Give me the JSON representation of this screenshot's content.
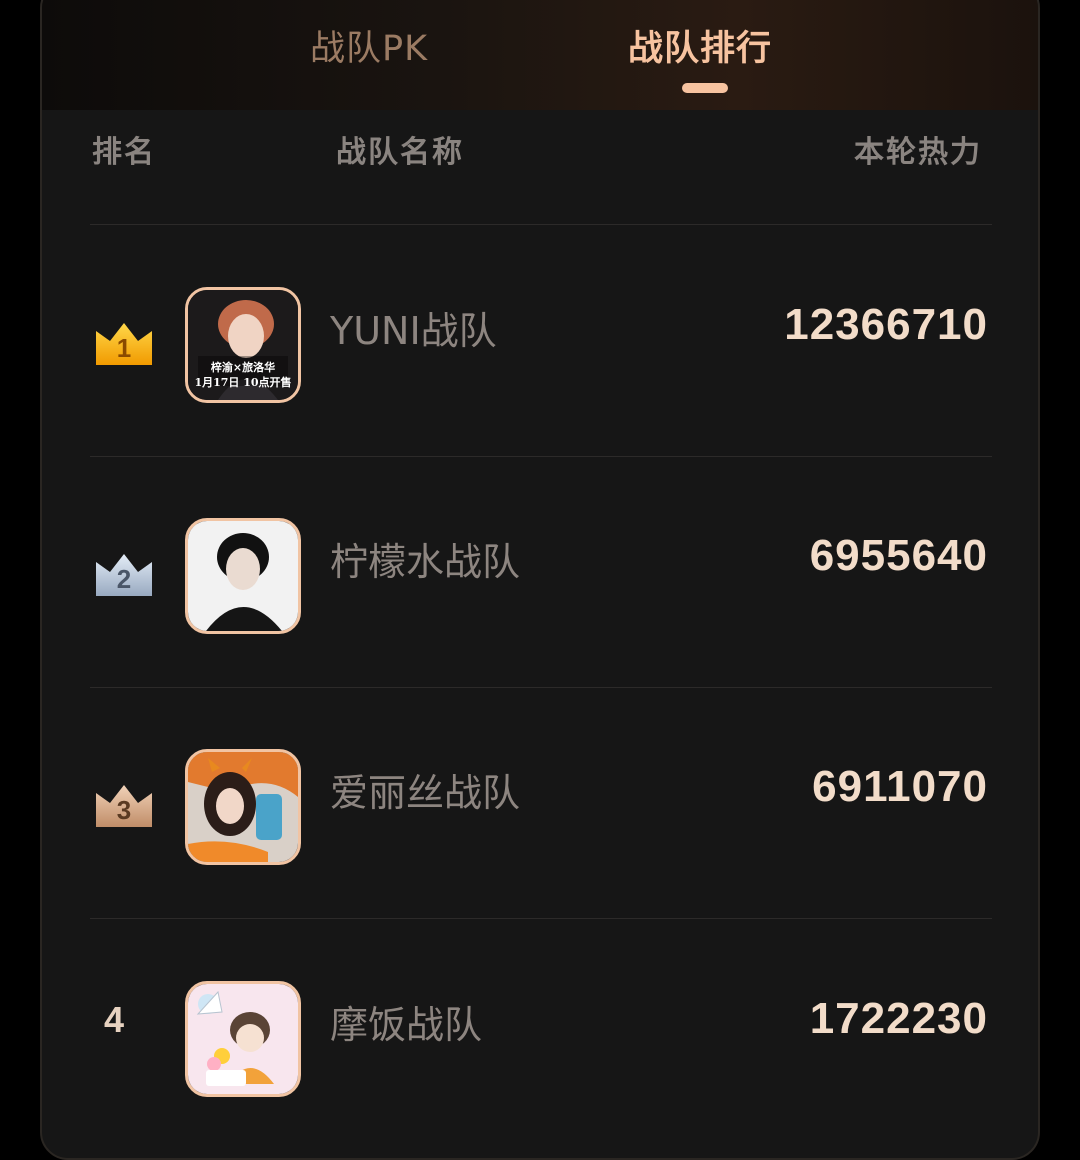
{
  "tabs": [
    {
      "label": "战队PK",
      "active": false
    },
    {
      "label": "战队排行",
      "active": true
    }
  ],
  "header": {
    "rank": "排名",
    "name": "战队名称",
    "heat": "本轮热力"
  },
  "rows": [
    {
      "rank": "1",
      "badge": "gold-crown-icon",
      "name": "YUNI战队",
      "heat": "12366710",
      "avatar_text": [
        "梓渝×旅洛华",
        "1月17日 10点开售"
      ]
    },
    {
      "rank": "2",
      "badge": "silver-crown-icon",
      "name": "柠檬水战队",
      "heat": "6955640"
    },
    {
      "rank": "3",
      "badge": "bronze-crown-icon",
      "name": "爱丽丝战队",
      "heat": "6911070"
    },
    {
      "rank": "4",
      "badge": null,
      "name": "摩饭战队",
      "heat": "1722230"
    }
  ],
  "colors": {
    "accent": "#f7c3a0",
    "background": "#161616",
    "gold": "#f5b400",
    "silver": "#b7c6d9",
    "bronze": "#d4a684"
  }
}
